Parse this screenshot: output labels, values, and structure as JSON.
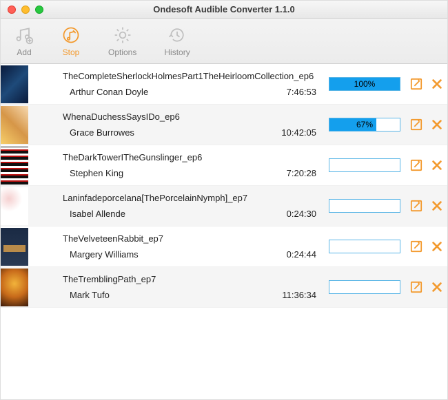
{
  "window": {
    "title": "Ondesoft Audible Converter 1.1.0"
  },
  "toolbar": {
    "add": {
      "label": "Add"
    },
    "stop": {
      "label": "Stop"
    },
    "options": {
      "label": "Options"
    },
    "history": {
      "label": "History"
    }
  },
  "rows": [
    {
      "title": "TheCompleteSherlockHolmesPart1TheHeirloomCollection_ep6",
      "author": "Arthur Conan Doyle",
      "duration": "7:46:53",
      "progress_pct": 100,
      "progress_label": "100%"
    },
    {
      "title": "WhenaDuchessSaysIDo_ep6",
      "author": "Grace Burrowes",
      "duration": "10:42:05",
      "progress_pct": 67,
      "progress_label": "67%"
    },
    {
      "title": "TheDarkTowerITheGunslinger_ep6",
      "author": "Stephen King",
      "duration": "7:20:28",
      "progress_pct": 0,
      "progress_label": ""
    },
    {
      "title": "Laninfadeporcelana[ThePorcelainNymph]_ep7",
      "author": "Isabel Allende",
      "duration": "0:24:30",
      "progress_pct": 0,
      "progress_label": ""
    },
    {
      "title": "TheVelveteenRabbit_ep7",
      "author": "Margery Williams",
      "duration": "0:24:44",
      "progress_pct": 0,
      "progress_label": ""
    },
    {
      "title": "TheTremblingPath_ep7",
      "author": "Mark Tufo",
      "duration": "11:36:34",
      "progress_pct": 0,
      "progress_label": ""
    }
  ]
}
